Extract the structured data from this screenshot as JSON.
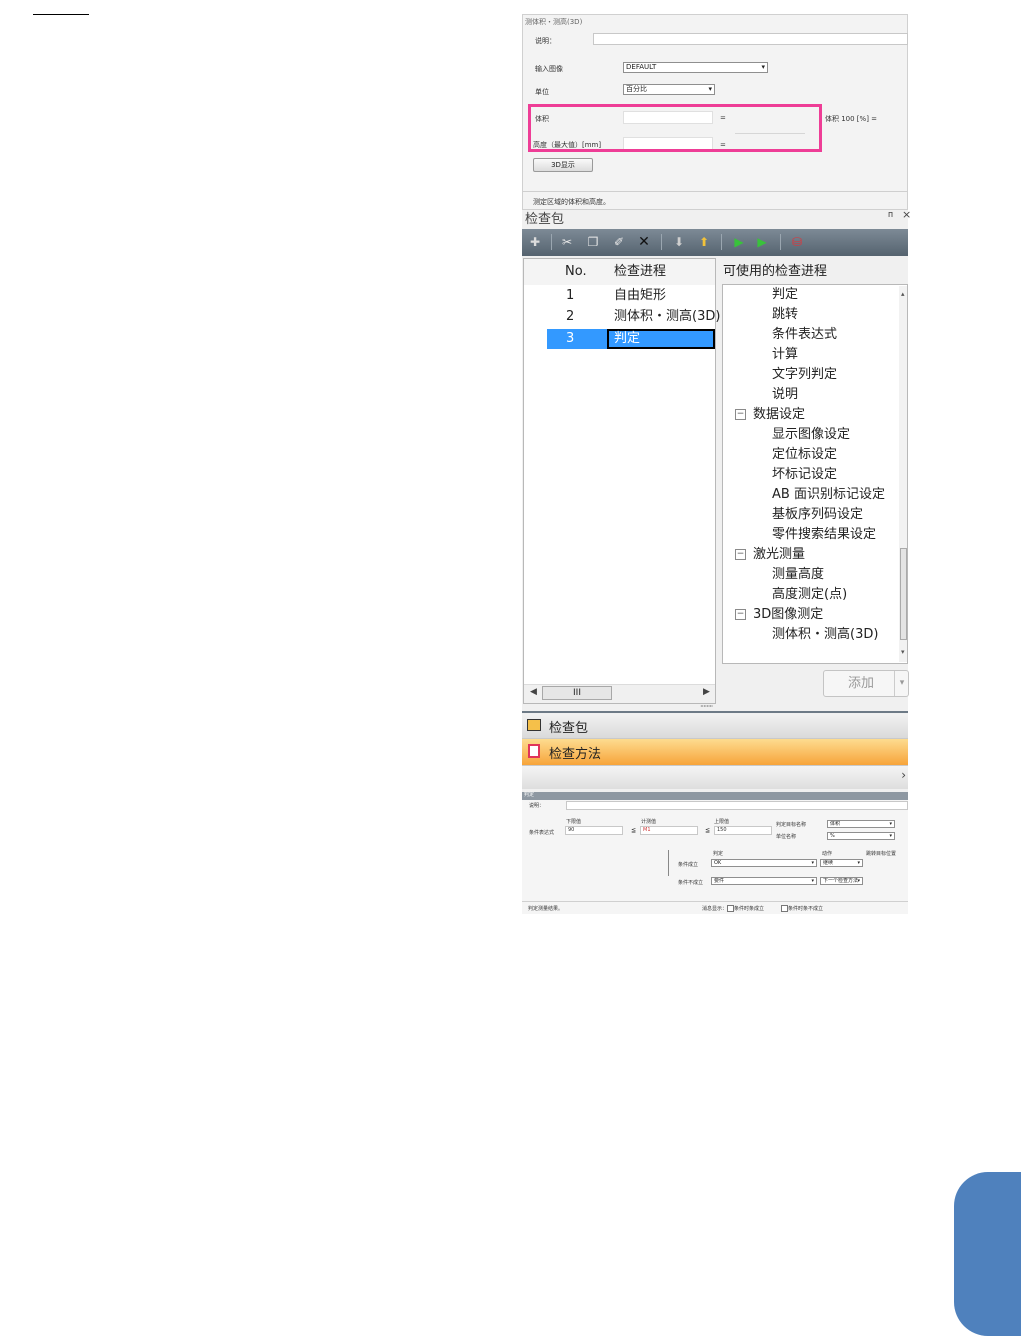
{
  "top_panel": {
    "title": "测体积・测高(3D)",
    "desc_label": "说明：",
    "input_image_label": "输入图像",
    "input_image_value": "DEFAULT",
    "unit_label": "单位",
    "unit_value": "百分比",
    "volume_label": "体积",
    "height_label": "高度（最大值）[mm]",
    "eq1": "=",
    "eq2": "=",
    "volume100_label": "体积 100 [%] =",
    "btn_3d": "3D显示",
    "status": "测定区域的体积和高度。"
  },
  "highlight_color": "#ee3d96",
  "inspection_panel": {
    "title": "检查包",
    "pin": "ᴨ",
    "close": "×",
    "list_headers": {
      "no": "No.",
      "process": "检查进程"
    },
    "rows": [
      {
        "no": "1",
        "name": "自由矩形"
      },
      {
        "no": "2",
        "name": "测体积・测高(3D)"
      },
      {
        "no": "3",
        "name": "判定"
      }
    ],
    "scroll_thumb": "III",
    "available_header": "可使用的检查进程",
    "tree": {
      "items_top": [
        "判定",
        "跳转",
        "条件表达式",
        "计算",
        "文字列判定",
        "说明"
      ],
      "cat_data": "数据设定",
      "items_data": [
        "显示图像设定",
        "定位标设定",
        "坏标记设定",
        "AB 面识别标记设定",
        "基板序列码设定",
        "零件搜索结果设定"
      ],
      "cat_laser": "激光测量",
      "items_laser": [
        "测量高度",
        "高度测定(点)"
      ],
      "cat_3d": "3D图像测定",
      "items_3d": [
        "测体积・测高(3D)"
      ],
      "expander": "−"
    },
    "add_button": "添加",
    "splitter": "········",
    "nav_package": "检查包",
    "nav_method": "检查方法",
    "collapse_arrow": "›"
  },
  "bottom_panel": {
    "title": "判定",
    "desc_label": "说明：",
    "lower_label": "下限值",
    "measured_label": "计测值",
    "upper_label": "上限值",
    "cond_expr_label": "条件表达式",
    "lower_value": "90",
    "le1": "≦",
    "measured_value": "M1",
    "le2": "≦",
    "upper_value": "150",
    "judge_target_label": "判定目标名称",
    "judge_target_value": "体积",
    "unit_label": "单位名称",
    "unit_value": "%",
    "result_label": "判定",
    "action_label": "动作",
    "jump_label": "跳转目标位置",
    "cond_true_label": "条件成立",
    "cond_true_result": "OK",
    "cond_true_action": "继续",
    "cond_false_label": "条件不成立",
    "cond_false_result": "要件",
    "cond_false_action": "下一个检查方法",
    "status_left": "判定测量结果。",
    "status_mid": "消息显示：",
    "chk1": "条件时条成立",
    "chk2": "条件时条不成立"
  },
  "colors": {
    "blue_tab": "#4f81bd",
    "selected_row": "#3399ff",
    "toolbar_bg": "#5d6b78",
    "orange": "#f7a43a"
  }
}
